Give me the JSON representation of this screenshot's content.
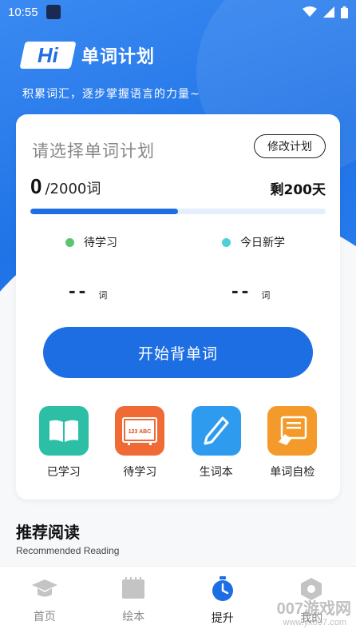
{
  "status_bar": {
    "time": "10:55"
  },
  "header": {
    "badge": "Hi",
    "title": "单词计划",
    "subtitle": "积累词汇，逐步掌握语言的力量~"
  },
  "plan": {
    "title": "请选择单词计划",
    "edit_label": "修改计划",
    "learned": "0",
    "total": "/2000词",
    "days_left": "剩200天",
    "progress_fraction": 0.5
  },
  "stats": {
    "pending": {
      "label": "待学习",
      "value": "--",
      "unit": "词",
      "color": "#5cc46f"
    },
    "today_new": {
      "label": "今日新学",
      "value": "--",
      "unit": "词",
      "color": "#4dd0d6"
    }
  },
  "start_button": "开始背单词",
  "quick_actions": [
    {
      "label": "已学习",
      "icon": "book-icon",
      "color": "#2dbfa6"
    },
    {
      "label": "待学习",
      "icon": "board-icon",
      "color": "#f06a35"
    },
    {
      "label": "生词本",
      "icon": "pen-icon",
      "color": "#2e9bef"
    },
    {
      "label": "单词自检",
      "icon": "check-board-icon",
      "color": "#f39a2a"
    }
  ],
  "board_text": "123 ABC",
  "reading": {
    "title": "推荐阅读",
    "subtitle": "Recommended Reading"
  },
  "nav": [
    {
      "label": "首页",
      "icon": "graduation-cap-icon",
      "active": false
    },
    {
      "label": "绘本",
      "icon": "picture-book-icon",
      "active": false
    },
    {
      "label": "提升",
      "icon": "stopwatch-icon",
      "active": true
    },
    {
      "label": "我的",
      "icon": "hexagon-icon",
      "active": false
    }
  ],
  "watermark": {
    "text": "007游戏网",
    "sub": "www.yx007.com"
  },
  "colors": {
    "primary": "#1e6ee3",
    "track": "#e4effd"
  }
}
